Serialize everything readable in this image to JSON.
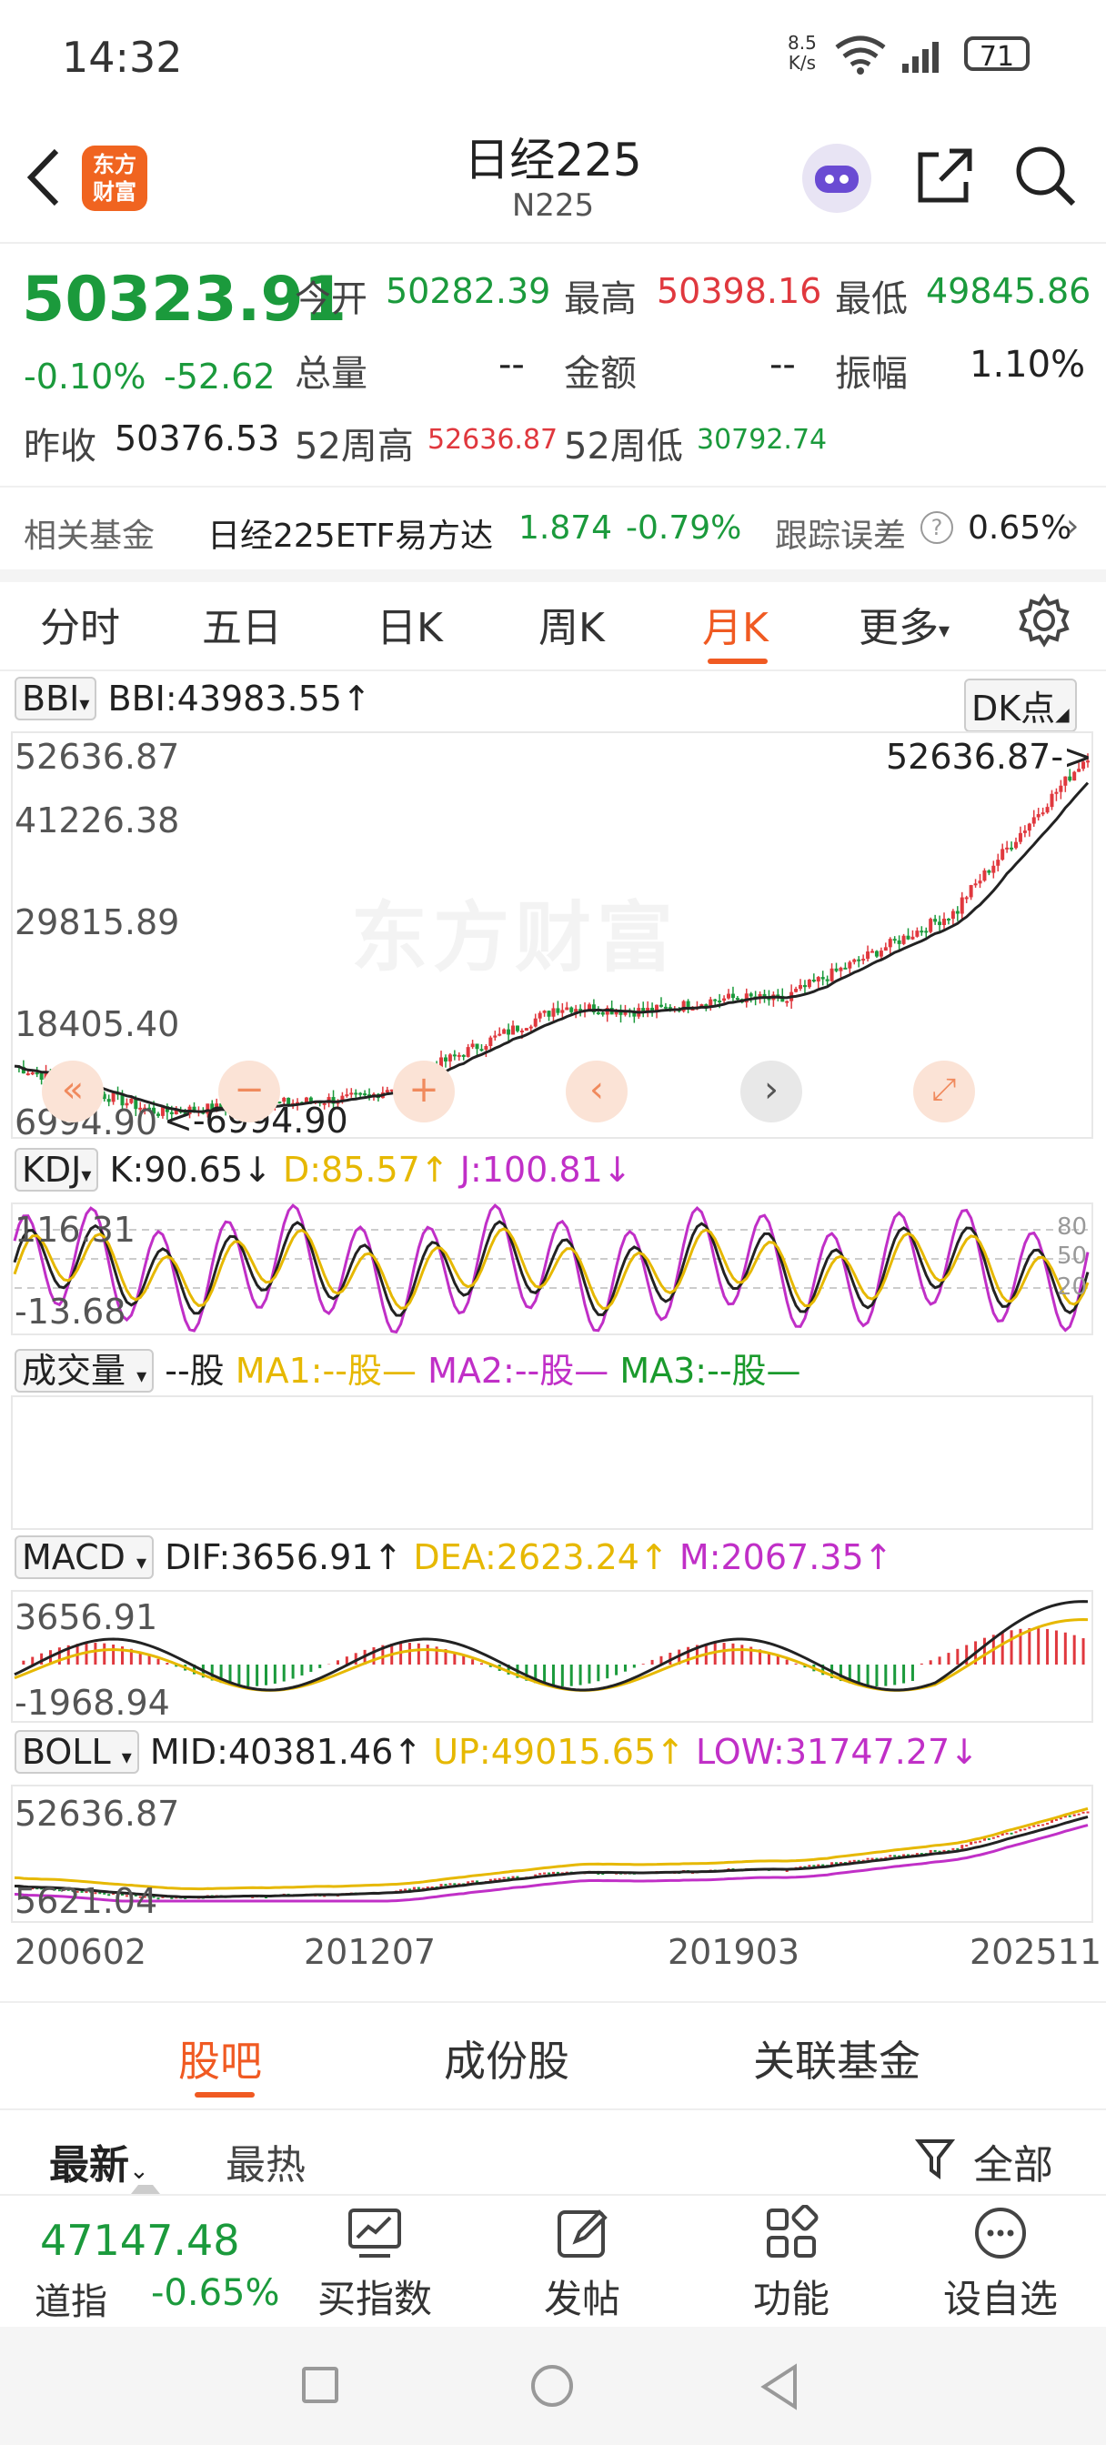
{
  "status": {
    "time": "14:32",
    "net_speed_top": "8.5",
    "net_speed_bottom": "K/s",
    "battery": "71"
  },
  "header": {
    "logo_text_1": "东方",
    "logo_text_2": "财富",
    "title": "日经225",
    "code": "N225"
  },
  "quote": {
    "price": "50323.91",
    "change_pct": "-0.10%",
    "change": "-52.62",
    "open_label": "今开",
    "open": "50282.39",
    "high_label": "最高",
    "high": "50398.16",
    "low_label": "最低",
    "low": "49845.86",
    "volume_label": "总量",
    "volume": "--",
    "amount_label": "金额",
    "amount": "--",
    "amplitude_label": "振幅",
    "amplitude": "1.10%",
    "prev_close_label": "昨收",
    "prev_close": "50376.53",
    "w52_high_label": "52周高",
    "w52_high": "52636.87",
    "w52_low_label": "52周低",
    "w52_low": "30792.74"
  },
  "fund": {
    "label": "相关基金",
    "name": "日经225ETF易方达",
    "price": "1.874",
    "change": "-0.79%",
    "tracking_label": "跟踪误差",
    "tracking_value": "0.65%"
  },
  "tabs": [
    {
      "label": "分时"
    },
    {
      "label": "五日"
    },
    {
      "label": "日K"
    },
    {
      "label": "周K"
    },
    {
      "label": "月K",
      "active": true
    },
    {
      "label": "更多"
    }
  ],
  "kline": {
    "selector": "BBI",
    "indicator": "BBI:43983.55↑",
    "dk_label": "DK点",
    "yaxis": [
      "52636.87",
      "41226.38",
      "29815.89",
      "18405.40",
      "6994.90"
    ],
    "max_marker": "52636.87->",
    "min_marker": "<-6994.90",
    "watermark": "东方财富"
  },
  "kdj": {
    "selector": "KDJ",
    "k": "K:90.65↓",
    "d": "D:85.57↑",
    "j": "J:100.81↓",
    "ytop": "116.31",
    "ybottom": "-13.68",
    "levels": [
      "80",
      "50",
      "20"
    ]
  },
  "volume": {
    "selector": "成交量",
    "value": "--股",
    "ma1": "MA1:--股—",
    "ma2": "MA2:--股—",
    "ma3": "MA3:--股—"
  },
  "macd": {
    "selector": "MACD",
    "dif": "DIF:3656.91↑",
    "dea": "DEA:2623.24↑",
    "m": "M:2067.35↑",
    "ytop": "3656.91",
    "ybottom": "-1968.94"
  },
  "boll": {
    "selector": "BOLL",
    "mid": "MID:40381.46↑",
    "up": "UP:49015.65↑",
    "low": "LOW:31747.27↓",
    "ytop": "52636.87",
    "ybottom": "5621.04"
  },
  "xaxis": [
    "200602",
    "201207",
    "201903",
    "202511"
  ],
  "bottom_tabs": [
    {
      "label": "股吧",
      "active": true
    },
    {
      "label": "成份股"
    },
    {
      "label": "关联基金"
    }
  ],
  "sort": {
    "latest": "最新",
    "hot": "最热",
    "filter": "全部"
  },
  "bottom_bar": {
    "index_price": "47147.48",
    "index_name": "道指",
    "index_change": "-0.65%",
    "items": [
      {
        "label": "买指数"
      },
      {
        "label": "发帖"
      },
      {
        "label": "功能"
      },
      {
        "label": "设自选"
      }
    ]
  },
  "colors": {
    "up": "#e0383e",
    "down": "#1b9a3c",
    "accent": "#f05a22",
    "yellow": "#e6b800",
    "magenta": "#c02fc7"
  }
}
